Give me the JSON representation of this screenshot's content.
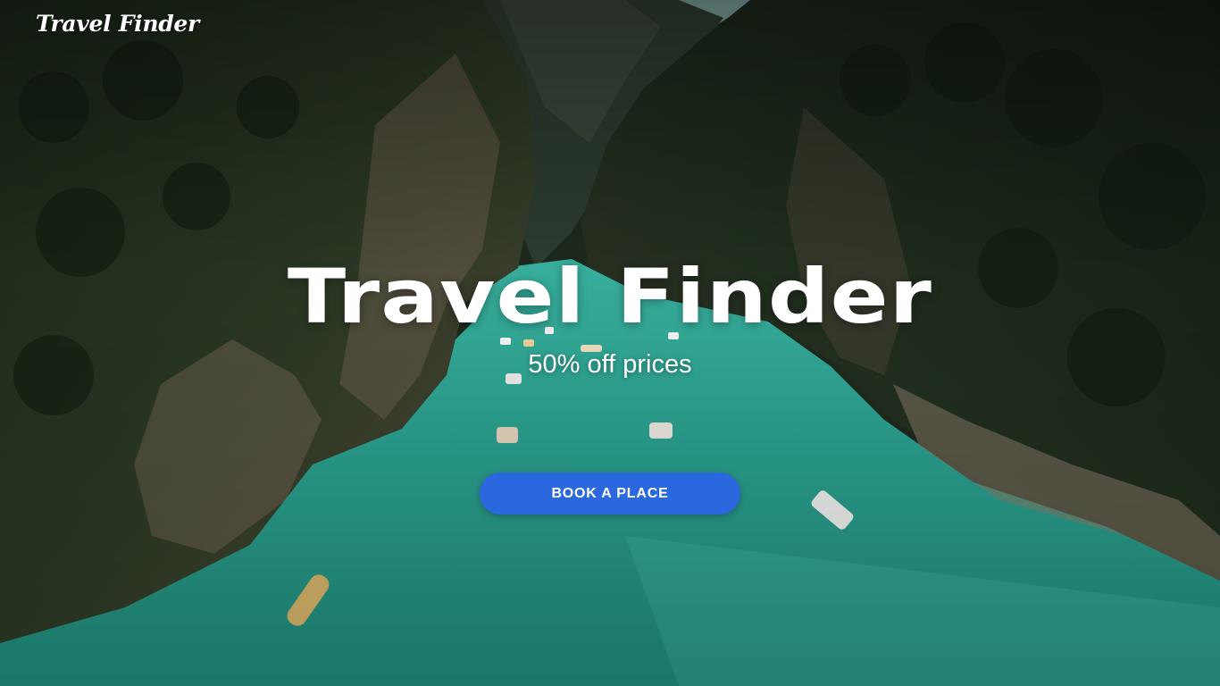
{
  "header": {
    "brand": "Travel Finder"
  },
  "hero": {
    "title": "Travel Finder",
    "subtitle": "50% off prices",
    "cta_label": "BOOK A PLACE",
    "background": "aerial-canyon-river-with-boats"
  },
  "colors": {
    "cta_background": "#2b67de",
    "text": "#ffffff",
    "water": "#27a291",
    "cliff_dark": "#1c2a1d"
  }
}
